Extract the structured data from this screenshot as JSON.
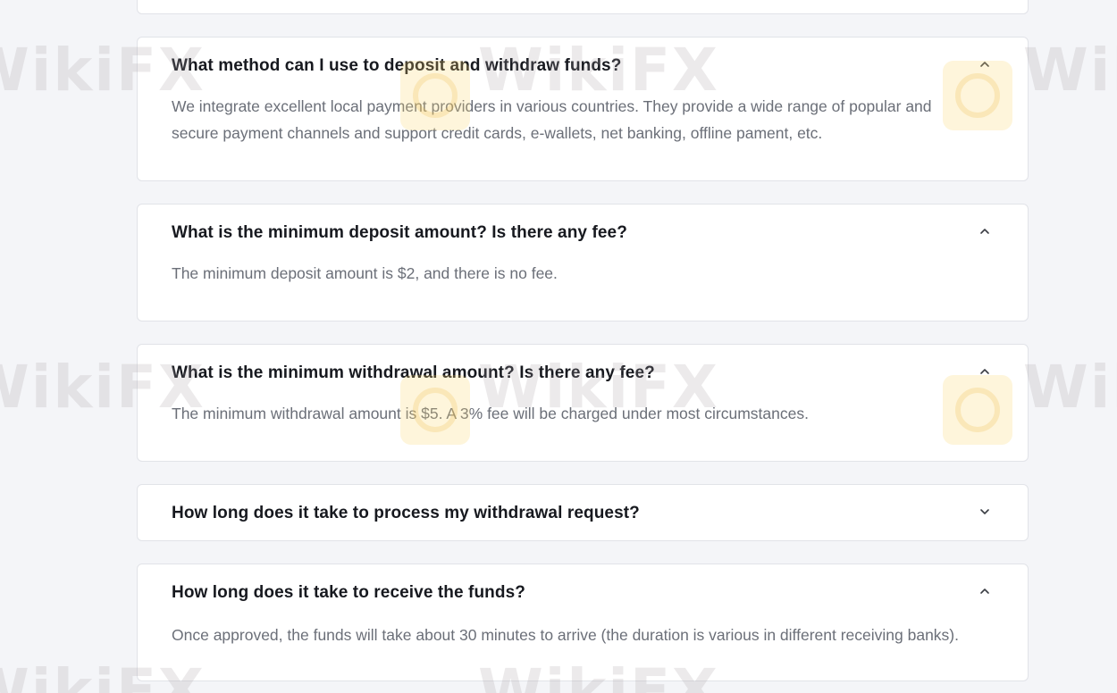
{
  "faq": {
    "items": [
      {
        "question": "What method can I use to deposit and withdraw funds?",
        "answer": "We integrate excellent local payment providers in various countries. They provide a wide range of popular and secure payment channels and support credit cards, e-wallets, net banking, offline pament, etc.",
        "expanded": true
      },
      {
        "question": "What is the minimum deposit amount? Is there any fee?",
        "answer": "The minimum deposit amount is $2, and there is no fee.",
        "expanded": true
      },
      {
        "question": "What is the minimum withdrawal amount? Is there any fee?",
        "answer": "The minimum withdrawal amount is $5. A 3% fee will be charged under most circumstances.",
        "expanded": true
      },
      {
        "question": "How long does it take to process my withdrawal request?",
        "answer": "",
        "expanded": false
      },
      {
        "question": "How long does it take to receive the funds?",
        "answer": "Once approved, the funds will take about 30 minutes to arrive (the duration is various in different receiving banks).",
        "expanded": true
      }
    ],
    "icons": {
      "expanded": "chevron-up-icon",
      "collapsed": "chevron-down-icon"
    }
  },
  "watermark": {
    "text": "WikiFX"
  },
  "colors": {
    "background": "#f4f5f8",
    "card": "#ffffff",
    "question": "#17191f",
    "answer": "#6b6f78"
  }
}
